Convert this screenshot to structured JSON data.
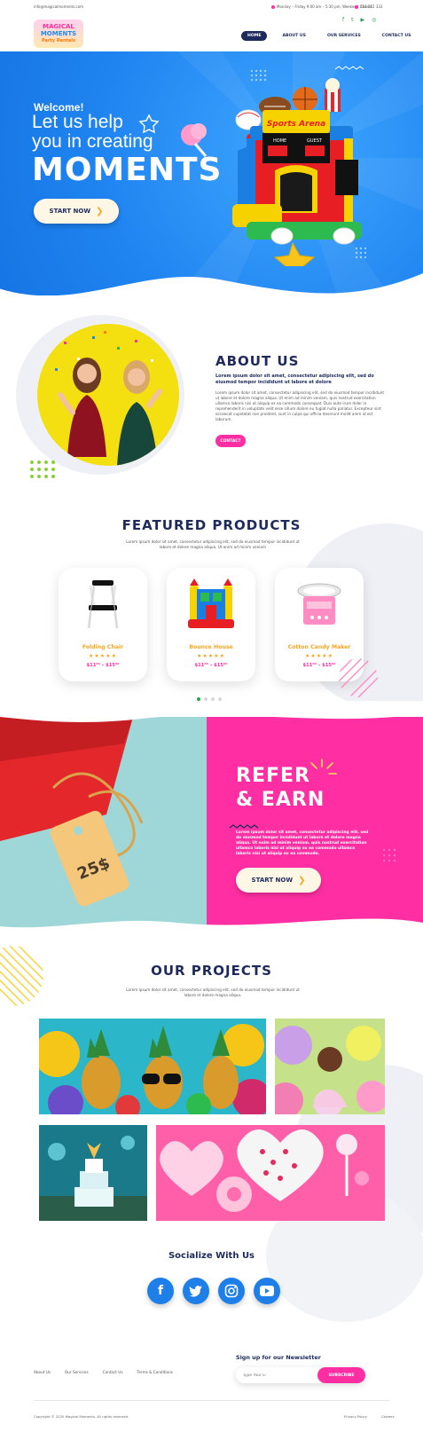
{
  "topbar": {
    "email": "info@magicalmoments.com",
    "hours": "Monday – Friday 9:00 am – 5:30 pm, Weekend Closed",
    "phone": "111 222 333"
  },
  "logo": {
    "line1": "MAGICAL",
    "line2": "MOMENTS",
    "line3": "Party Rentals"
  },
  "social_top": [
    "facebook-icon",
    "twitter-icon",
    "youtube-icon",
    "instagram-icon"
  ],
  "nav": {
    "items": [
      "HOME",
      "ABOUT US",
      "OUR SERVICES",
      "CONTACT US"
    ]
  },
  "hero": {
    "welcome": "Welcome!",
    "line1": "Let us help",
    "line2": "you in creating",
    "line3": "MOMENTS",
    "button": "START NOW",
    "scoreboard": {
      "title": "Sports Arena",
      "home": "HOME",
      "guest": "GUEST"
    }
  },
  "about": {
    "title": "ABOUT US",
    "subtitle": "Lorem ipsum dolor sit amet, consectetur adipiscing elit, sed do eiusmod tempor incididunt ut labore et dolore",
    "body": "Lorem ipsum dolor sit amet, consectetur adipiscing elit, sed do eiusmod tempor incididunt ut labore et dolore magna aliqua. Ut enim ad minim veniam, quis nostrud exercitation ullamco laboris nisi ut aliquip ex ea commodo consequat. Duis aute irure dolor in reprehenderit in voluptate velit esse cillum dolore eu fugiat nulla pariatur. Excepteur sint occaecat cupidatat non proident, sunt in culpa qui officia deserunt mollit anim id est laborum.",
    "button": "CONTACT"
  },
  "featured": {
    "title": "FEATURED PRODUCTS",
    "text": "Lorem ipsum dolor sit amet, consectetur adipiscing elit, sed do eiusmod tempor incididunt ut labore et dolore magna aliqua. Ut enim ad minim veniam",
    "products": [
      {
        "name": "Folding Chair",
        "stars": "★★★★★",
        "price": "$11⁰⁰ – $15⁰⁰"
      },
      {
        "name": "Bounce House",
        "stars": "★★★★★",
        "price": "$11⁰⁰ – $15⁰⁰"
      },
      {
        "name": "Cotton Candy Maker",
        "stars": "★★★★★",
        "price": "$11⁰⁰ – $15⁰⁰"
      }
    ]
  },
  "refer": {
    "title1": "REFER",
    "title2": "& EARN",
    "body": "Lorem ipsum dolor sit amet, consectetur adipiscing elit, sed do eiusmod tempor incididunt ut labore et dolore magna aliqua. Ut enim ad minim veniam, quis nostrud exercitation ullamco laboris nisi ut aliquip ex ea commodo ullamco laboris nisi ut aliquip ex ea commodo.",
    "tag": "25$",
    "button": "START NOW"
  },
  "projects": {
    "title": "OUR PROJECTS",
    "text": "Lorem ipsum dolor sit amet, consectetur adipiscing elit, sed do eiusmod tempor incididunt ut labore et dolore magna aliqua."
  },
  "social": {
    "title": "Socialize With Us",
    "icons": [
      "facebook-icon",
      "twitter-icon",
      "instagram-icon",
      "youtube-icon"
    ]
  },
  "newsletter": {
    "title": "Sign up for our Newsletter",
    "placeholder": "Type Your E-",
    "button": "SUBSCRIBE"
  },
  "footer": {
    "links": [
      "About Us",
      "Our Services",
      "Contact Us",
      "Terms & Conditions"
    ],
    "copyright": "Copyright © 2020 Magical Moments. All rights reserved.",
    "legal": [
      "Privacy Policy",
      "Careers"
    ]
  },
  "colors": {
    "navy": "#1d2a5b",
    "blue": "#1f84f0",
    "pink": "#ff2fa3",
    "orange": "#f5a623",
    "green": "#2e9d4f",
    "teal": "#9fd7d9"
  }
}
